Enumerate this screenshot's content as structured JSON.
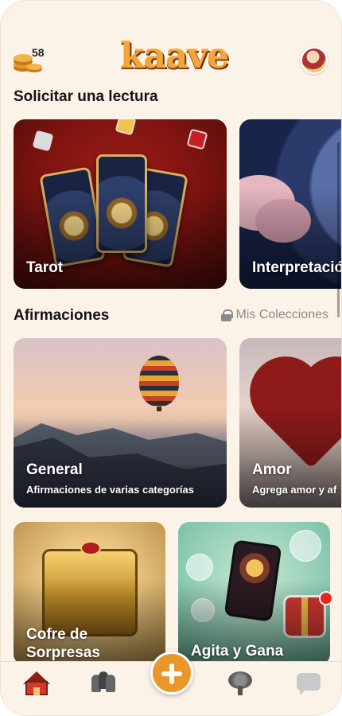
{
  "header": {
    "coins_count": "58",
    "logo_text": "kaave"
  },
  "sections": {
    "readings_title": "Solicitar una lectura",
    "affirmations_title": "Afirmaciones",
    "collections_link": "Mis Colecciones"
  },
  "readings": [
    {
      "title": "Tarot"
    },
    {
      "title": "Interpretación"
    }
  ],
  "affirmations": [
    {
      "title": "General",
      "subtitle": "Afirmaciones de varias categorías"
    },
    {
      "title": "Amor",
      "subtitle": "Agrega amor y af"
    }
  ],
  "promos": [
    {
      "title": "Cofre de Sorpresas"
    },
    {
      "title": "Agita y Gana"
    }
  ],
  "icons": {
    "coins": "coins-icon",
    "avatar": "avatar-icon",
    "lock": "lock-icon",
    "home": "home-icon",
    "people": "people-icon",
    "plus": "plus-icon",
    "tree": "tree-icon",
    "chat": "chat-icon"
  },
  "colors": {
    "background": "#fcf3e8",
    "accent": "#e9962b",
    "notification": "#e52620"
  }
}
